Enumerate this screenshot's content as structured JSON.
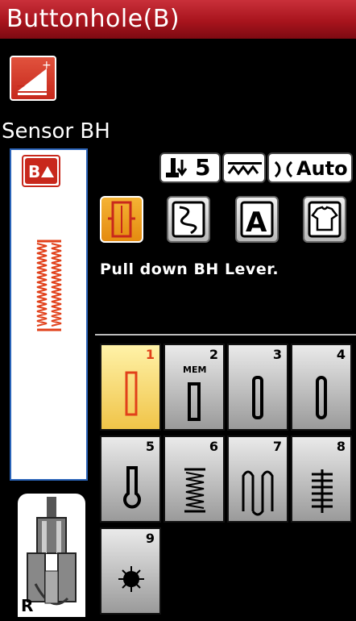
{
  "header": {
    "title": "Buttonhole(B)"
  },
  "sensor_label": "Sensor BH",
  "settings": {
    "foot_height": "5",
    "auto_label": "Auto"
  },
  "message": "Pull down BH Lever.",
  "left_panel": {
    "foot_letter": "R"
  },
  "mem_label": "MEM",
  "stitches": [
    {
      "number": "1",
      "selected": true
    },
    {
      "number": "2"
    },
    {
      "number": "3"
    },
    {
      "number": "4"
    },
    {
      "number": "5"
    },
    {
      "number": "6"
    },
    {
      "number": "7"
    },
    {
      "number": "8"
    },
    {
      "number": "9"
    }
  ],
  "colors": {
    "accent_red": "#c8281c",
    "selected_yellow": "#f0c448",
    "title_red": "#a8141d"
  }
}
